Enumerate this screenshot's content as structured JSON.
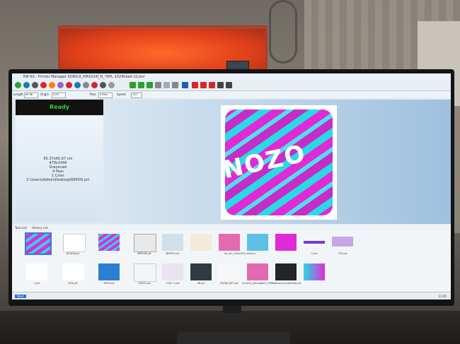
{
  "window": {
    "title": "RIP-ES - Printer Manager KONICA_KM1024I_N_76PL 1024head 1Color"
  },
  "status": {
    "ready": "Ready"
  },
  "image_info": [
    "65.37x65.67 cm",
    "479x1440",
    "Grayscale",
    "4 Pass",
    "1 Color",
    "C:\\Users\\Admin\\Desktop\\RIP005.prt"
  ],
  "options": {
    "length_label": "Length",
    "length_value": "65.66",
    "origin_label": "Origin",
    "origin_value": "0.00",
    "pass_label": "Pass",
    "pass_value": "4 Pass",
    "speed_label": "Speed",
    "dpi_value": "720"
  },
  "tabs": [
    "Task List",
    "History List"
  ],
  "preview": {
    "logo_text": "NOZO"
  },
  "thumbnails": [
    {
      "caption": ""
    },
    {
      "caption": "JM 808.prt"
    },
    {
      "caption": ""
    },
    {
      "caption": "ВРМЭЯ.prt"
    },
    {
      "caption": "BOPVЭ.prt"
    },
    {
      "caption": ""
    },
    {
      "caption": "lol_prt_150x150_печать"
    },
    {
      "caption": ""
    },
    {
      "caption": ""
    },
    {
      "caption": "1.prt"
    },
    {
      "caption": "732.prt"
    },
    {
      "caption": "1.prt"
    },
    {
      "caption": "003.prt"
    },
    {
      "caption": "ФОН.prt"
    },
    {
      "caption": "7В100.prt"
    },
    {
      "caption": "11ЕС.1.prt"
    },
    {
      "caption": "2В.prt"
    },
    {
      "caption": "ПУЛЬСАР7.prt"
    },
    {
      "caption": "печать_расширен_150x150.prt"
    },
    {
      "caption": "Главная.усиленная.prt"
    },
    {
      "caption": ""
    }
  ],
  "taskbar": {
    "start": "Start",
    "clock": "11:05"
  },
  "colors": {
    "accent_magenta": "#e02ad6",
    "accent_cyan": "#2ad9e3",
    "ready_green": "#35d235"
  }
}
